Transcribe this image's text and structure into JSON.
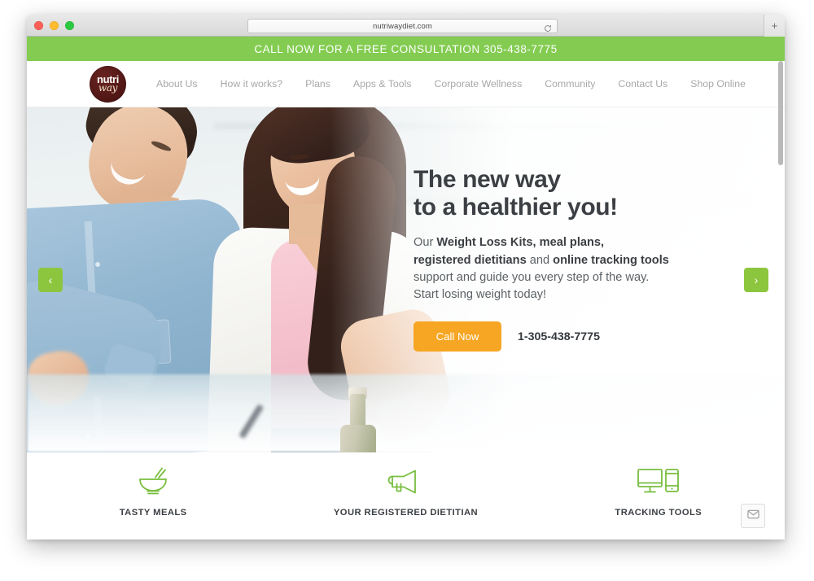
{
  "browser": {
    "url": "nutriwaydiet.com",
    "reload_icon": "reload-icon",
    "new_tab_label": "+",
    "traffic_lights": [
      "close",
      "minimize",
      "zoom"
    ]
  },
  "site": {
    "callbar": {
      "text": "CALL NOW FOR A FREE CONSULTATION 305-438-7775",
      "background": "#83cc51"
    },
    "logo": {
      "line1": "nutri",
      "line2": "way",
      "background": "#4c1513"
    },
    "nav": {
      "items": [
        {
          "label": "About Us"
        },
        {
          "label": "How it works?"
        },
        {
          "label": "Plans"
        },
        {
          "label": "Apps & Tools"
        },
        {
          "label": "Corporate Wellness"
        },
        {
          "label": "Community"
        },
        {
          "label": "Contact Us"
        },
        {
          "label": "Shop Online"
        }
      ]
    },
    "hero": {
      "heading_line1": "The new way",
      "heading_line2": "to a healthier you!",
      "paragraph": {
        "p1_plain": "Our ",
        "p1_bold": "Weight Loss Kits, meal plans,",
        "p2_bold_a": "registered dietitians",
        "p2_plain": " and ",
        "p2_bold_b": "online tracking tools",
        "p3": "support and guide you every step of the way.",
        "p4": "Start losing weight today!"
      },
      "cta_label": "Call Now",
      "cta_color": "#f6a623",
      "phone": "1-305-438-7775",
      "prev_arrow": "‹",
      "next_arrow": "›",
      "arrow_color": "#8cc63e"
    },
    "features": [
      {
        "icon": "bowl-chopsticks-icon",
        "label": "TASTY MEALS"
      },
      {
        "icon": "megaphone-icon",
        "label": "YOUR REGISTERED DIETITIAN"
      },
      {
        "icon": "desktop-mobile-icon",
        "label": "TRACKING TOOLS"
      }
    ],
    "email_widget": {
      "icon": "envelope-icon"
    },
    "accent_green": "#8cc63e"
  }
}
